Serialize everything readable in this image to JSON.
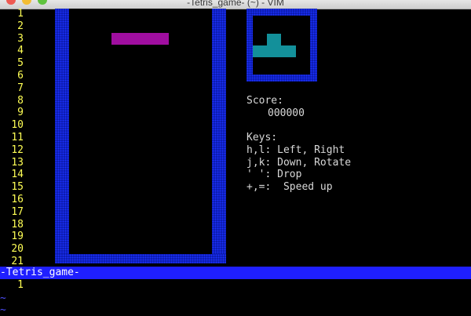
{
  "window": {
    "title": "-Tetris_game- (~) - VIM"
  },
  "editor": {
    "line_numbers": [
      "1",
      "2",
      "3",
      "4",
      "5",
      "6",
      "7",
      "8",
      "9",
      "10",
      "11",
      "12",
      "13",
      "14",
      "15",
      "16",
      "17",
      "18",
      "19",
      "20",
      "21"
    ],
    "status_line": "-Tetris_game-",
    "cmd_line_number": "1",
    "tilde_lines": [
      "~",
      "~"
    ]
  },
  "game": {
    "current_piece": {
      "type": "I",
      "color": "#a00ea0"
    },
    "next_piece": {
      "type": "T",
      "color": "#13909a"
    },
    "score_label": "Score:",
    "score_value": "000000",
    "keys_heading": "Keys:",
    "key_bindings": [
      "h,l: Left, Right",
      "j,k: Down, Rotate",
      "' ': Drop",
      "+,=:  Speed up"
    ],
    "colors": {
      "wall": "#0a18a8",
      "line_number": "#ffff55",
      "status_bar": "#1f1fff"
    }
  }
}
